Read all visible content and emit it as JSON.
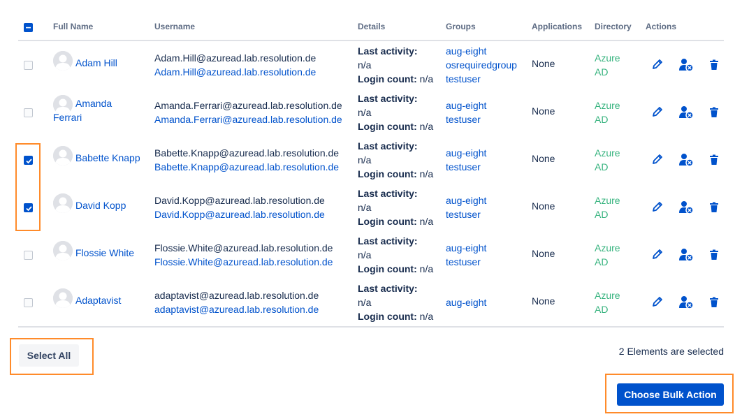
{
  "table": {
    "headers": {
      "full_name": "Full Name",
      "username": "Username",
      "details": "Details",
      "groups": "Groups",
      "applications": "Applications",
      "directory": "Directory",
      "actions": "Actions"
    },
    "details_labels": {
      "last_activity": "Last activity:",
      "login_count": "Login count:"
    },
    "rows": [
      {
        "name_first": "Adam Hill",
        "name_second": "",
        "username": "Adam.Hill@azuread.lab.resolution.de",
        "email": "Adam.Hill@azuread.lab.resolution.de",
        "last_activity": "n/a",
        "login_count": "n/a",
        "groups": [
          "aug-eight",
          "osrequiredgroup",
          "testuser"
        ],
        "applications": "None",
        "directory": "Azure AD",
        "checked": false
      },
      {
        "name_first": "Amanda",
        "name_second": "Ferrari",
        "username": "Amanda.Ferrari@azuread.lab.resolution.de",
        "email": "Amanda.Ferrari@azuread.lab.resolution.de",
        "last_activity": "n/a",
        "login_count": "n/a",
        "groups": [
          "aug-eight",
          "testuser"
        ],
        "applications": "None",
        "directory": "Azure AD",
        "checked": false
      },
      {
        "name_first": "Babette Knapp",
        "name_second": "",
        "username": "Babette.Knapp@azuread.lab.resolution.de",
        "email": "Babette.Knapp@azuread.lab.resolution.de",
        "last_activity": "n/a",
        "login_count": "n/a",
        "groups": [
          "aug-eight",
          "testuser"
        ],
        "applications": "None",
        "directory": "Azure AD",
        "checked": true
      },
      {
        "name_first": "David Kopp",
        "name_second": "",
        "username": "David.Kopp@azuread.lab.resolution.de",
        "email": "David.Kopp@azuread.lab.resolution.de",
        "last_activity": "n/a",
        "login_count": "n/a",
        "groups": [
          "aug-eight",
          "testuser"
        ],
        "applications": "None",
        "directory": "Azure AD",
        "checked": true
      },
      {
        "name_first": "Flossie White",
        "name_second": "",
        "username": "Flossie.White@azuread.lab.resolution.de",
        "email": "Flossie.White@azuread.lab.resolution.de",
        "last_activity": "n/a",
        "login_count": "n/a",
        "groups": [
          "aug-eight",
          "testuser"
        ],
        "applications": "None",
        "directory": "Azure AD",
        "checked": false
      },
      {
        "name_first": "Adaptavist",
        "name_second": "",
        "username": "adaptavist@azuread.lab.resolution.de",
        "email": "adaptavist@azuread.lab.resolution.de",
        "last_activity": "n/a",
        "login_count": "n/a",
        "groups": [
          "aug-eight"
        ],
        "applications": "None",
        "directory": "Azure AD",
        "checked": false
      }
    ]
  },
  "footer": {
    "select_all_label": "Select All",
    "selection_status": "2 Elements are selected",
    "bulk_action_label": "Choose Bulk Action"
  },
  "colors": {
    "link": "#0052cc",
    "directory": "#36b37e",
    "highlight": "#ff8b2a",
    "primary_button": "#0052cc"
  },
  "icons": {
    "edit": "pencil-icon",
    "remove_user": "user-remove-icon",
    "delete": "trash-icon"
  }
}
